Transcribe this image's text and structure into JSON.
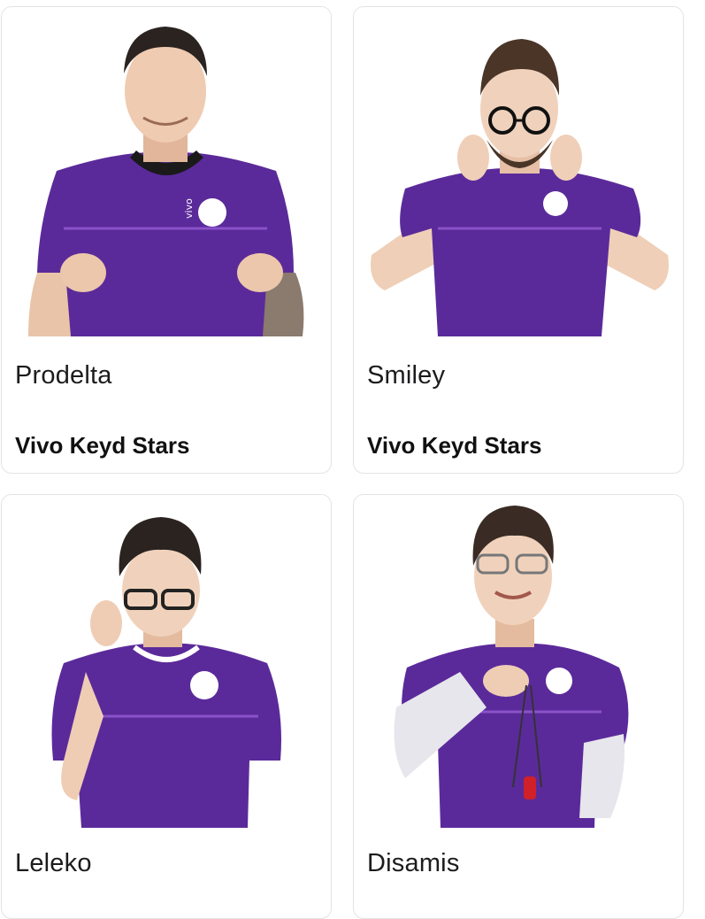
{
  "accent": {
    "jersey": "#5b2a9a",
    "jersey_dark": "#3f1a72",
    "stripe": "#8a52c8"
  },
  "players": [
    {
      "name": "Prodelta",
      "team": "Vivo Keyd Stars",
      "icon": "player-photo"
    },
    {
      "name": "Smiley",
      "team": "Vivo Keyd Stars",
      "icon": "player-photo"
    },
    {
      "name": "Leleko",
      "team": "",
      "icon": "player-photo"
    },
    {
      "name": "Disamis",
      "team": "",
      "icon": "player-photo"
    }
  ],
  "jersey_text": {
    "brand": "vivo"
  }
}
